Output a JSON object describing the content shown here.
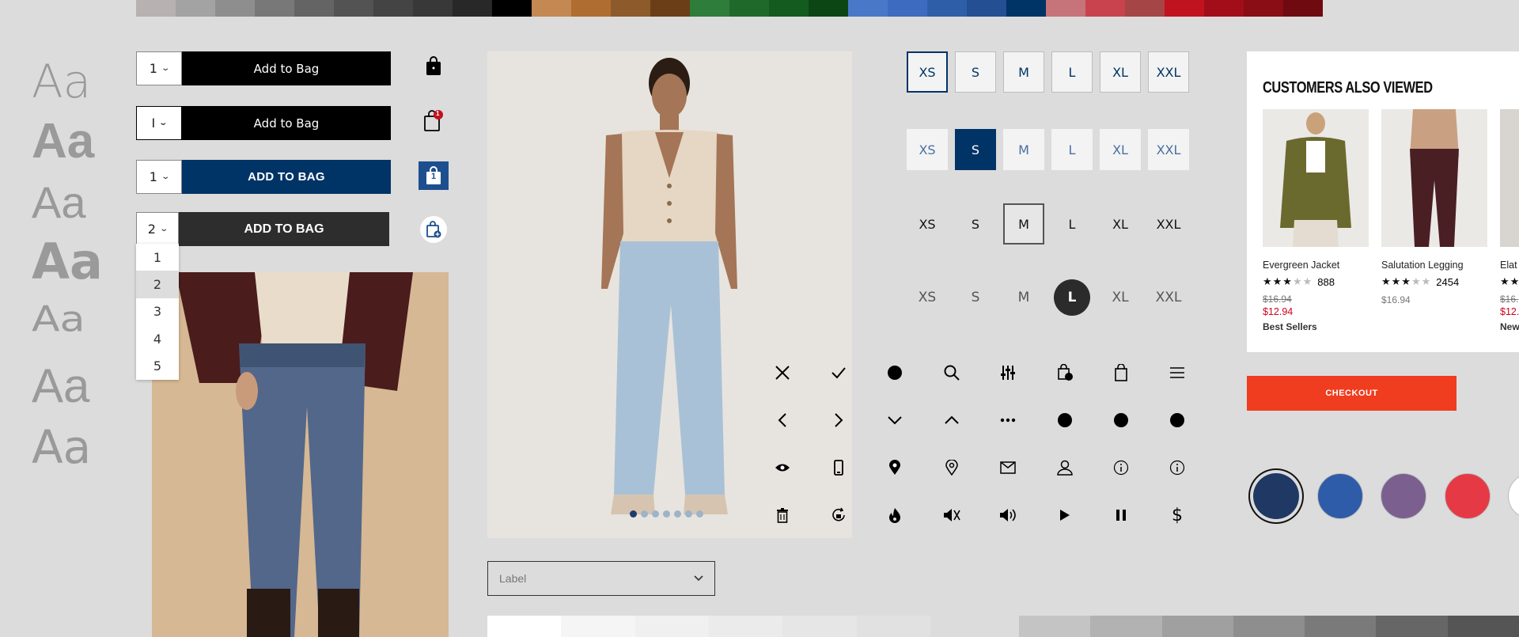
{
  "palette": [
    "#b8b1b1",
    "#a3a3a3",
    "#8e8e8e",
    "#787878",
    "#646464",
    "#535353",
    "#444444",
    "#383838",
    "#282828",
    "#000000",
    "#c48852",
    "#b06d32",
    "#8d5a2b",
    "#6b3e17",
    "#2e7d3a",
    "#1f6a2b",
    "#135b1f",
    "#0c4615",
    "#4a78c9",
    "#3d6bc0",
    "#2f5ea9",
    "#244f93",
    "#003366",
    "#c6737a",
    "#c9434f",
    "#a64545",
    "#c1121f",
    "#a10e1a",
    "#8a0c15",
    "#700a11"
  ],
  "typography": {
    "sample": "Aa"
  },
  "add_to_bag": [
    {
      "qty": "1",
      "label": "Add to Bag",
      "bg": "#000000"
    },
    {
      "qty": "I",
      "label": "Add to Bag",
      "bg": "#000000"
    },
    {
      "qty": "1",
      "label": "ADD TO BAG",
      "bg": "#003366"
    },
    {
      "qty": "2",
      "label": "ADD TO BAG",
      "bg": "#2d2d2d"
    }
  ],
  "bag_badges": {
    "b2": "1",
    "b3": "1"
  },
  "qty_options": [
    "1",
    "2",
    "3",
    "4",
    "5"
  ],
  "qty_selected": "2",
  "sizes": [
    "XS",
    "S",
    "M",
    "L",
    "XL",
    "XXL"
  ],
  "size_selected_rows": {
    "row1": "XS",
    "row2": "S",
    "row3": "M",
    "row4": "L"
  },
  "carousel": {
    "count": 7,
    "active": 1
  },
  "dropdown_field": {
    "placeholder": "Label"
  },
  "customers_also_viewed": {
    "title": "CUSTOMERS ALSO VIEWED",
    "products": [
      {
        "name": "Evergreen Jacket",
        "rating": 3,
        "reviews": "888",
        "was": "$16.94",
        "price": "$12.94",
        "badge": "Best Sellers"
      },
      {
        "name": "Salutation Legging",
        "rating": 3,
        "reviews": "2454",
        "price": "$16.94"
      },
      {
        "name": "Elat",
        "rating": 1,
        "was": "$16.",
        "price": "$12.",
        "badge": "New"
      }
    ]
  },
  "checkout_label": "CHECKOUT",
  "color_swatches": [
    "#1f3864",
    "#2f5ca8",
    "#7b5f8f",
    "#e63946",
    "#ffffff"
  ],
  "accent": "#003366",
  "icons": [
    "close-icon",
    "check-icon",
    "dot-icon",
    "search-icon",
    "filter-icon",
    "bag-add-icon",
    "bag-icon",
    "menu-icon",
    "chevron-left-icon",
    "chevron-right-icon",
    "chevron-down-icon",
    "chevron-up-icon",
    "more-icon",
    "dot-icon",
    "dot-icon",
    "dot-icon",
    "eye-icon",
    "phone-icon",
    "location-filled-icon",
    "location-icon",
    "mail-icon",
    "user-icon",
    "info-icon",
    "info-icon",
    "trash-icon",
    "rotate-lock-icon",
    "fire-icon",
    "mute-icon",
    "volume-icon",
    "play-icon",
    "pause-icon",
    "dollar-icon"
  ]
}
